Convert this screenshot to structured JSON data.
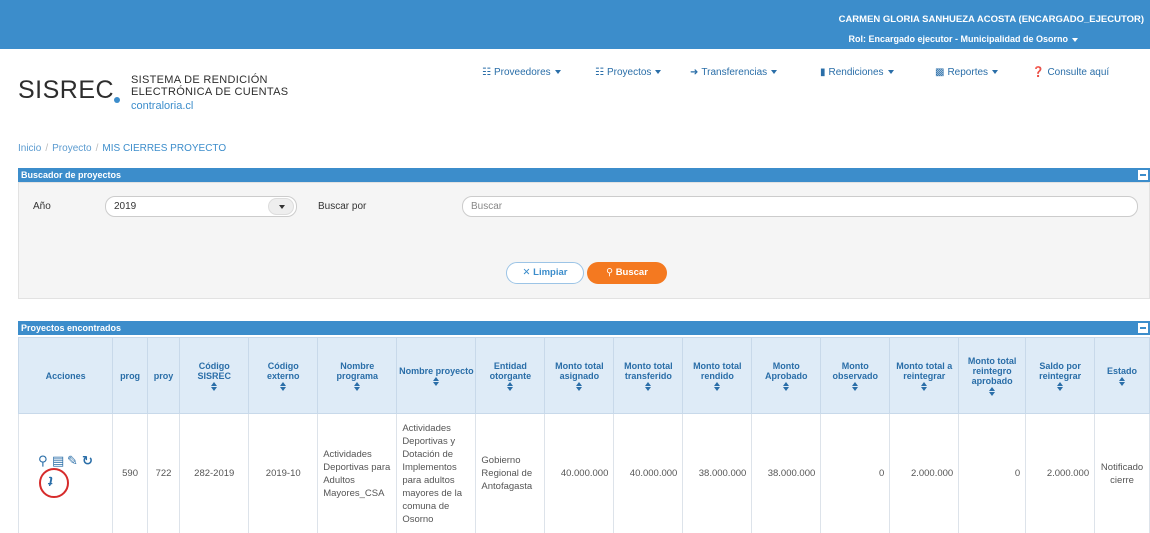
{
  "header": {
    "user_name": "CARMEN GLORIA SANHUEZA ACOSTA (ENCARGADO_EJECUTOR)",
    "user_role": "Rol: Encargado ejecutor - Municipalidad de Osorno"
  },
  "logo": {
    "name": "SISREC",
    "line1": "SISTEMA DE RENDICIÓN",
    "line2": "ELECTRÓNICA DE CUENTAS",
    "site": "contraloria.cl"
  },
  "nav": [
    {
      "label": "Proveedores",
      "icon": "calendar-icon"
    },
    {
      "label": "Proyectos",
      "icon": "calendar-icon"
    },
    {
      "label": "Transferencias",
      "icon": "arrow-right-icon"
    },
    {
      "label": "Rendiciones",
      "icon": "book-icon"
    },
    {
      "label": "Reportes",
      "icon": "bar-chart-icon"
    },
    {
      "label": "Consulte aquí",
      "icon": "question-icon"
    }
  ],
  "breadcrumb": {
    "home": "Inicio",
    "section": "Proyecto",
    "current": "MIS CIERRES PROYECTO"
  },
  "search_panel": {
    "title": "Buscador de proyectos",
    "year_label": "Año",
    "year_value": "2019",
    "search_by_label": "Buscar por",
    "search_placeholder": "Buscar",
    "clear_label": "Limpiar",
    "search_label": "Buscar"
  },
  "results_panel": {
    "title": "Proyectos encontrados",
    "columns": [
      "Acciones",
      "prog",
      "proy",
      "Código SISREC",
      "Código externo",
      "Nombre programa",
      "Nombre proyecto",
      "Entidad otorgante",
      "Monto total asignado",
      "Monto total transferido",
      "Monto total rendido",
      "Monto Aprobado",
      "Monto observado",
      "Monto total a reintegrar",
      "Monto total reintegro aprobado",
      "Saldo por reintegrar",
      "Estado"
    ],
    "rows": [
      {
        "prog": "590",
        "proy": "722",
        "codigo_sisrec": "282-2019",
        "codigo_externo": "2019-10",
        "nombre_programa": "Actividades Deportivas para Adultos Mayores_CSA",
        "nombre_proyecto": "Actividades Deportivas y Dotación de Implementos para adultos mayores de la comuna de Osorno",
        "entidad_otorgante": "Gobierno Regional de Antofagasta",
        "monto_asignado": "40.000.000",
        "monto_transferido": "40.000.000",
        "monto_rendido": "38.000.000",
        "monto_aprobado": "38.000.000",
        "monto_observado": "0",
        "monto_a_reintegrar": "2.000.000",
        "monto_reintegro_aprobado": "0",
        "saldo_por_reintegrar": "2.000.000",
        "estado": "Notificado cierre"
      }
    ]
  },
  "colors": {
    "brand_blue": "#3c8dcb",
    "accent_orange": "#f47920",
    "highlight_red": "#d62b2b"
  }
}
